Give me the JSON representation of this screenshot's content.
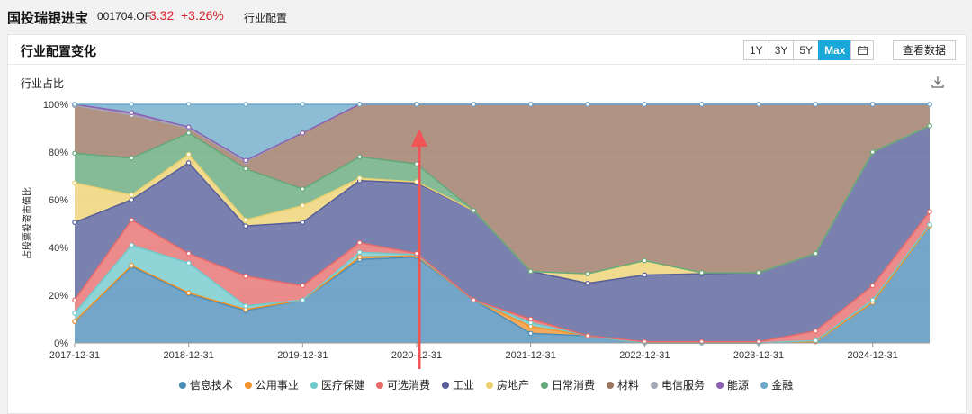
{
  "header": {
    "fund_name": "国投瑞银进宝",
    "fund_code": "001704.OF",
    "price": "3.32",
    "change": "+3.26%",
    "section": "行业配置"
  },
  "card": {
    "title": "行业配置变化",
    "ranges": [
      "1Y",
      "3Y",
      "5Y",
      "Max"
    ],
    "active_range": "Max",
    "view_data": "查看数据",
    "subtitle": "行业占比"
  },
  "colors": {
    "price": "#d4242c",
    "accent": "#1aa7d9"
  },
  "chart_data": {
    "type": "area",
    "stacked": true,
    "title": "",
    "xlabel": "",
    "ylabel": "占股票投资市值比",
    "ylim": [
      0,
      100
    ],
    "y_ticks": [
      "0%",
      "20%",
      "40%",
      "60%",
      "80%",
      "100%"
    ],
    "x_labels": [
      "2017-12-31",
      "2018-12-31",
      "2019-12-31",
      "2020-12-31",
      "2021-12-31",
      "2022-12-31",
      "2023-12-31",
      "2024-12-31"
    ],
    "x": [
      "2017-12-31",
      "2018-06-30",
      "2018-12-31",
      "2019-06-30",
      "2019-12-31",
      "2020-06-30",
      "2020-12-31",
      "2021-06-30",
      "2021-12-31",
      "2022-06-30",
      "2022-12-31",
      "2023-06-30",
      "2023-12-31",
      "2024-06-30",
      "2024-12-31",
      "2025-06-30"
    ],
    "legend_position": "bottom",
    "grid": true,
    "series": [
      {
        "name": "信息技术",
        "color": "#4b8db8",
        "cumulative": [
          9,
          32,
          20.5,
          13.5,
          18,
          35,
          36,
          18,
          4,
          3,
          0,
          0,
          0,
          0.5,
          17,
          49
        ]
      },
      {
        "name": "公用事业",
        "color": "#f0922b",
        "cumulative": [
          9,
          32.5,
          21,
          14,
          18,
          36,
          36.5,
          18,
          7,
          3,
          0,
          0,
          0,
          0.5,
          17,
          49
        ]
      },
      {
        "name": "医疗保健",
        "color": "#70c9cc",
        "cumulative": [
          12.5,
          41,
          33.5,
          15.5,
          18,
          38,
          37,
          18,
          8.5,
          3,
          0,
          0,
          0,
          1,
          18,
          49.5
        ]
      },
      {
        "name": "可选消费",
        "color": "#e76a6a",
        "cumulative": [
          18,
          51.5,
          37.5,
          28,
          24,
          42,
          37.5,
          18,
          10,
          3,
          0.5,
          0.5,
          0.5,
          5,
          24,
          55
        ]
      },
      {
        "name": "工业",
        "color": "#565d98",
        "cumulative": [
          50.5,
          60,
          75.5,
          49,
          50.5,
          68,
          67,
          55.5,
          30,
          25,
          28.5,
          29,
          29.5,
          37.5,
          80,
          91
        ]
      },
      {
        "name": "房地产",
        "color": "#ecd16e",
        "cumulative": [
          67,
          62,
          79,
          51.5,
          57.5,
          69,
          67.5,
          55.5,
          30,
          29,
          34.5,
          29.5,
          29.5,
          37.5,
          80,
          91
        ]
      },
      {
        "name": "日常消费",
        "color": "#63a87a",
        "cumulative": [
          79.5,
          77.5,
          88,
          73,
          64.5,
          78,
          75,
          55.5,
          30,
          29,
          34.5,
          29.5,
          29.5,
          37.5,
          80,
          91
        ]
      },
      {
        "name": "材料",
        "color": "#9b7562",
        "cumulative": [
          99.5,
          95.5,
          90,
          76,
          88,
          100,
          100,
          100,
          100,
          100,
          100,
          100,
          100,
          100,
          100,
          100
        ]
      },
      {
        "name": "电信服务",
        "color": "#a5a8b7",
        "cumulative": [
          99.5,
          95.5,
          90,
          76,
          88,
          100,
          100,
          100,
          100,
          100,
          100,
          100,
          100,
          100,
          100,
          100
        ]
      },
      {
        "name": "能源",
        "color": "#8a61b3",
        "cumulative": [
          100,
          96.5,
          90.5,
          76.5,
          88,
          100,
          100,
          100,
          100,
          100,
          100,
          100,
          100,
          100,
          100,
          100
        ]
      },
      {
        "name": "金融",
        "color": "#6da9c9",
        "cumulative": [
          100,
          100,
          100,
          100,
          100,
          100,
          100,
          100,
          100,
          100,
          100,
          100,
          100,
          100,
          100,
          100
        ]
      }
    ]
  }
}
